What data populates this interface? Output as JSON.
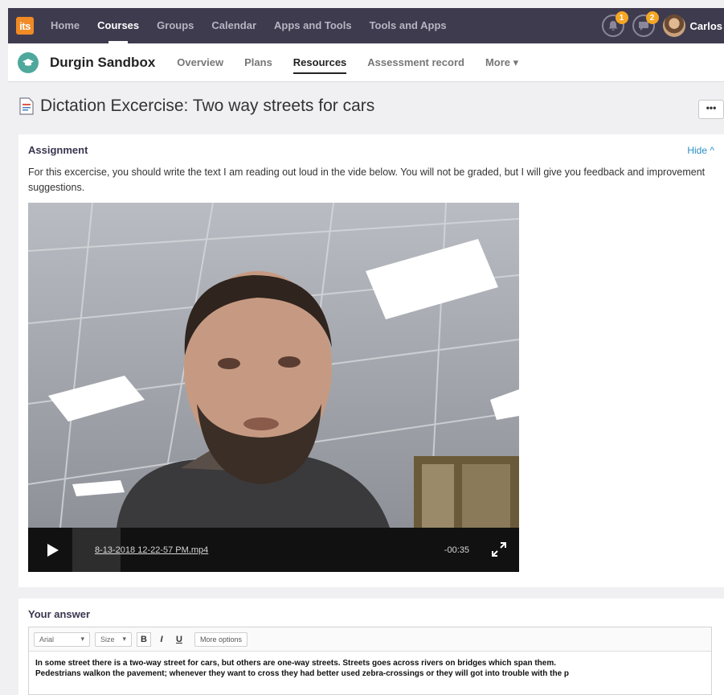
{
  "topbar": {
    "logo_text": "its",
    "nav": [
      "Home",
      "Courses",
      "Groups",
      "Calendar",
      "Apps and Tools",
      "Tools and Apps"
    ],
    "active_nav_index": 1,
    "notifications_badge": "1",
    "messages_badge": "2",
    "user_name": "Carlos",
    "bg_color": "#3f3b4e",
    "badge_color": "#f5a623"
  },
  "subnav": {
    "course_name": "Durgin Sandbox",
    "items": [
      "Overview",
      "Plans",
      "Resources",
      "Assessment record",
      "More ▾"
    ],
    "active_index": 2
  },
  "page": {
    "title": "Dictation Excercise: Two way streets for cars",
    "more_label": "•••"
  },
  "assignment": {
    "heading": "Assignment",
    "hide_label": "Hide ^",
    "text": "For this excercise, you should write the text I am reading out loud in the vide below. You will not be graded, but I will give you feedback and improvement suggestions.",
    "video": {
      "filename": "8-13-2018 12-22-57 PM.mp4",
      "time": "-00:35"
    }
  },
  "answer": {
    "heading": "Your answer",
    "font_select": "Arial",
    "size_select": "Size",
    "bold_label": "B",
    "italic_label": "I",
    "underline_label": "U",
    "more_options": "More options",
    "line1": "In some street there is a two-way street for cars, but others are one-way streets. Streets goes across rivers on bridges which span them.",
    "line2": "Pedestrians walkon the pavement; whenever they want to cross they had better used zebra-crossings or they will got into trouble with the p"
  }
}
